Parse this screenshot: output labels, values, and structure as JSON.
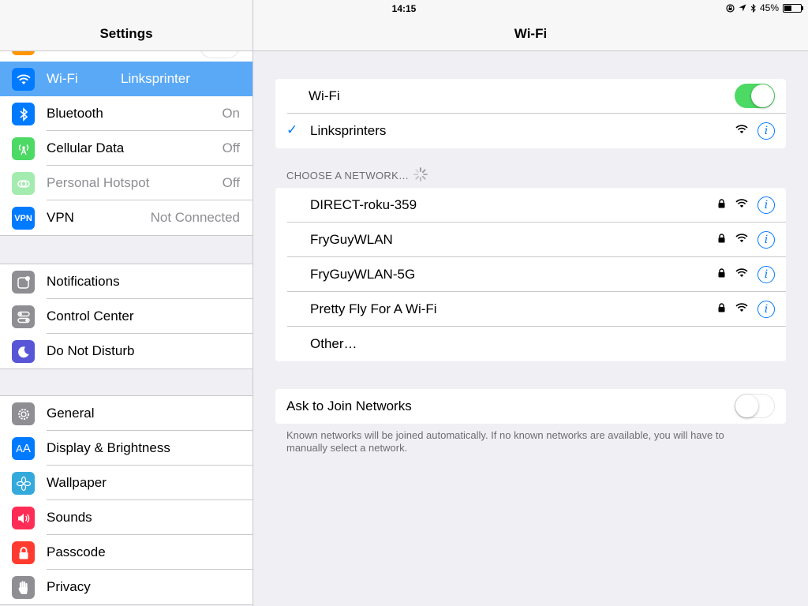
{
  "status_bar": {
    "device": "iPad",
    "time": "14:15",
    "battery": "45%",
    "battery_level": 0.45
  },
  "sidebar": {
    "title": "Settings",
    "groups": [
      {
        "items": [
          {
            "label": "Wi-Fi",
            "value": "Linksprinter",
            "icon": "wifi-icon",
            "color": "#007aff",
            "selected": true
          },
          {
            "label": "Bluetooth",
            "value": "On",
            "icon": "bluetooth-icon",
            "color": "#007aff"
          },
          {
            "label": "Cellular Data",
            "value": "Off",
            "icon": "cellular-icon",
            "color": "#4cd964"
          },
          {
            "label": "Personal Hotspot",
            "value": "Off",
            "icon": "hotspot-icon",
            "color": "#4cd964",
            "disabled": true
          },
          {
            "label": "VPN",
            "value": "Not Connected",
            "icon": "vpn-icon",
            "color": "#007aff"
          }
        ]
      },
      {
        "items": [
          {
            "label": "Notifications",
            "icon": "notifications-icon",
            "color": "#8e8e93"
          },
          {
            "label": "Control Center",
            "icon": "control-center-icon",
            "color": "#8e8e93"
          },
          {
            "label": "Do Not Disturb",
            "icon": "moon-icon",
            "color": "#5856d6"
          }
        ]
      },
      {
        "items": [
          {
            "label": "General",
            "icon": "gear-icon",
            "color": "#8e8e93"
          },
          {
            "label": "Display & Brightness",
            "icon": "display-icon",
            "color": "#007aff"
          },
          {
            "label": "Wallpaper",
            "icon": "wallpaper-icon",
            "color": "#34aadc"
          },
          {
            "label": "Sounds",
            "icon": "sound-icon",
            "color": "#ff2d55"
          },
          {
            "label": "Passcode",
            "icon": "lock-icon",
            "color": "#ff3b30"
          },
          {
            "label": "Privacy",
            "icon": "hand-icon",
            "color": "#8e8e93"
          }
        ]
      }
    ]
  },
  "main": {
    "title": "Wi-Fi",
    "wifi_label": "Wi-Fi",
    "wifi_on": true,
    "connected_network": "Linksprinters",
    "choose_label": "CHOOSE A NETWORK…",
    "networks": [
      {
        "name": "DIRECT-roku-359"
      },
      {
        "name": "FryGuyWLAN"
      },
      {
        "name": "FryGuyWLAN-5G"
      },
      {
        "name": "Pretty Fly For A Wi-Fi"
      }
    ],
    "other_label": "Other…",
    "ask_label": "Ask to Join Networks",
    "ask_on": false,
    "footnote": "Known networks will be joined automatically. If no known networks are available, you will have to manually select a network."
  }
}
